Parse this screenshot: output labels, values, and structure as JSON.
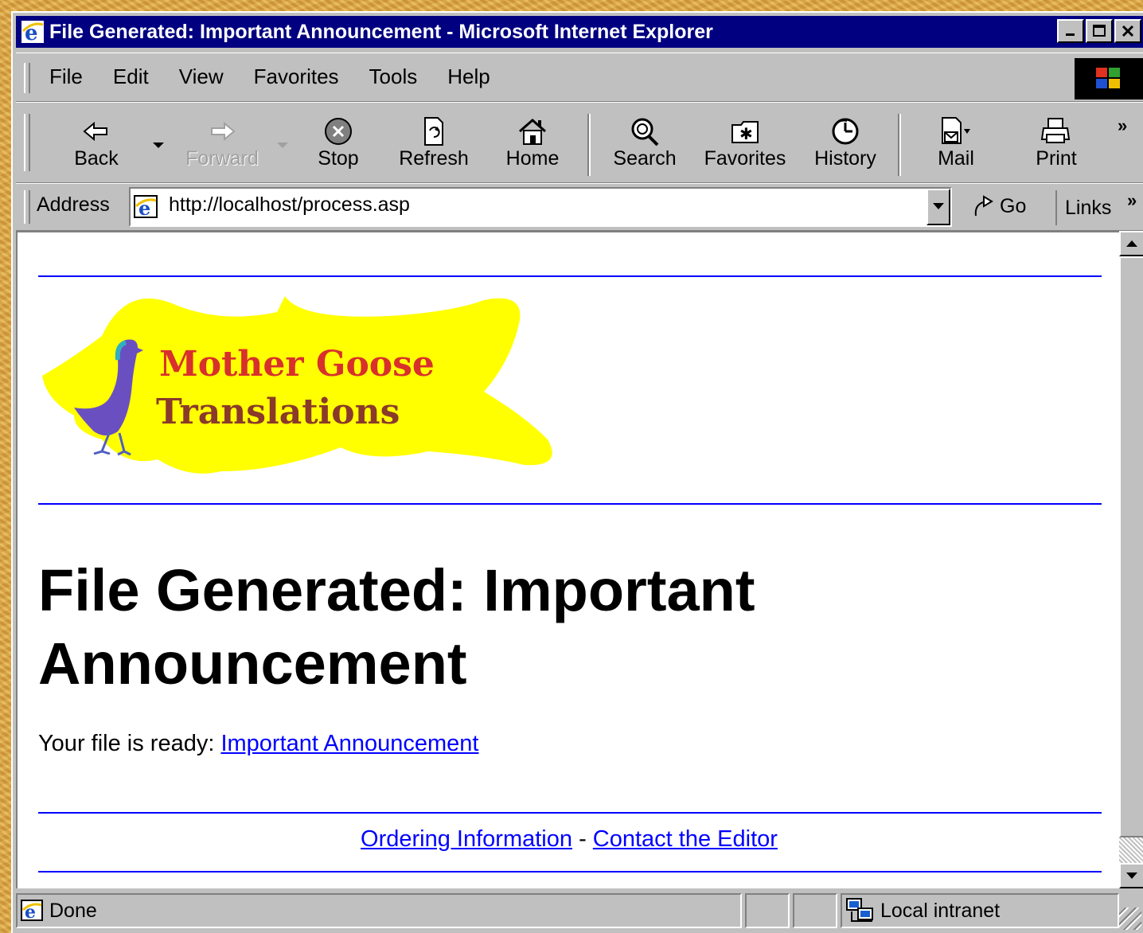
{
  "window": {
    "title": "File Generated: Important Announcement - Microsoft Internet Explorer"
  },
  "menu": [
    "File",
    "Edit",
    "View",
    "Favorites",
    "Tools",
    "Help"
  ],
  "toolbar": {
    "back": "Back",
    "forward": "Forward",
    "stop": "Stop",
    "refresh": "Refresh",
    "home": "Home",
    "search": "Search",
    "favorites": "Favorites",
    "history": "History",
    "mail": "Mail",
    "print": "Print",
    "more": "»"
  },
  "address": {
    "label": "Address",
    "url": "http://localhost/process.asp",
    "go": "Go",
    "links": "Links",
    "more": "»"
  },
  "page": {
    "logo_line1": "Mother Goose",
    "logo_line2": "Translations",
    "heading": "File Generated: Important Announcement",
    "ready_text": "Your file is ready: ",
    "file_link": "Important Announcement",
    "footer_link1": "Ordering Information",
    "footer_sep": " - ",
    "footer_link2": "Contact the Editor"
  },
  "status": {
    "text": "Done",
    "zone": "Local intranet"
  },
  "colors": {
    "titlebar": "#000080",
    "link": "#0000ff",
    "rule": "#0000ff",
    "chrome": "#c0c0c0",
    "logo_blob": "#ffff00"
  }
}
